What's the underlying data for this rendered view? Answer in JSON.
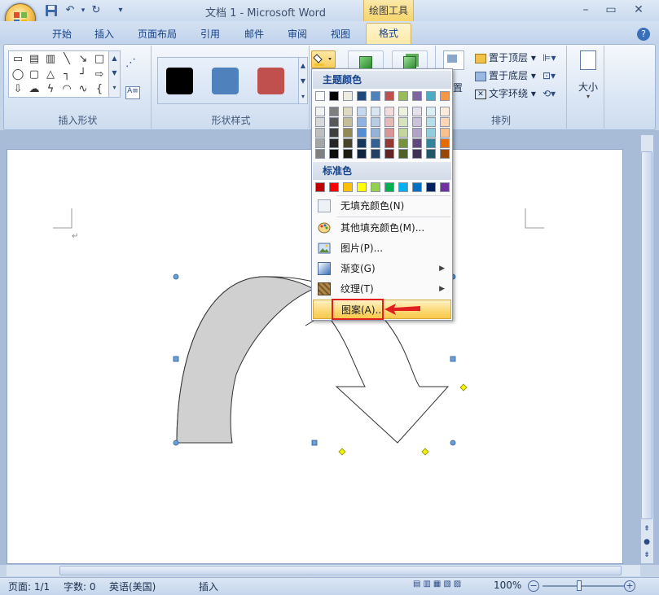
{
  "window": {
    "title": "文档 1 - Microsoft Word",
    "tool_context": "绘图工具",
    "controls": {
      "minimize": "–",
      "restore": "▭",
      "close": "✕"
    }
  },
  "qat": {
    "save": "save-icon",
    "undo": "undo-icon",
    "redo": "redo-icon",
    "customize": "▾"
  },
  "tabs": [
    "开始",
    "插入",
    "页面布局",
    "引用",
    "邮件",
    "审阅",
    "视图"
  ],
  "active_tab": "格式",
  "help": "?",
  "ribbon": {
    "insert_shapes_label": "插入形状",
    "shape_styles_label": "形状样式",
    "arrange_label": "排列",
    "size_label": "大小",
    "bring_front": "置于顶层",
    "send_back": "置于底层",
    "text_wrap": "文字环绕",
    "position_fragment": "置",
    "style_swatches": [
      "#000000",
      "#4f81bd",
      "#c0504d"
    ]
  },
  "fill_menu": {
    "theme_colors_title": "主题颜色",
    "standard_colors_title": "标准色",
    "theme_colors": [
      [
        "#ffffff",
        "#f2f2f2",
        "#d8d8d8",
        "#bfbfbf",
        "#a5a5a5",
        "#7f7f7f"
      ],
      [
        "#000000",
        "#7f7f7f",
        "#595959",
        "#3f3f3f",
        "#262626",
        "#0c0c0c"
      ],
      [
        "#eeece1",
        "#ddd9c3",
        "#c4bd97",
        "#938953",
        "#494429",
        "#1d1b10"
      ],
      [
        "#1f497d",
        "#c6d9f0",
        "#8db3e2",
        "#548dd4",
        "#17365d",
        "#0f243e"
      ],
      [
        "#4f81bd",
        "#dbe5f1",
        "#b8cce4",
        "#95b3d7",
        "#366092",
        "#244061"
      ],
      [
        "#c0504d",
        "#f2dcdb",
        "#e5b9b7",
        "#d99694",
        "#953734",
        "#632423"
      ],
      [
        "#9bbb59",
        "#ebf1dd",
        "#d7e3bc",
        "#c3d69b",
        "#76923c",
        "#4f6128"
      ],
      [
        "#8064a2",
        "#e5e0ec",
        "#ccc1d9",
        "#b2a2c7",
        "#5f497a",
        "#3f3151"
      ],
      [
        "#4bacc6",
        "#dbeef3",
        "#b7dde8",
        "#92cddc",
        "#31859b",
        "#205867"
      ],
      [
        "#f79646",
        "#fdeada",
        "#fbd5b5",
        "#fac08f",
        "#e36c09",
        "#974806"
      ]
    ],
    "standard_colors": [
      "#c00000",
      "#ff0000",
      "#ffc000",
      "#ffff00",
      "#92d050",
      "#00b050",
      "#00b0f0",
      "#0070c0",
      "#002060",
      "#7030a0"
    ],
    "items": {
      "no_fill": "无填充颜色(N)",
      "more_colors": "其他填充颜色(M)...",
      "picture": "图片(P)...",
      "gradient": "渐变(G)",
      "texture": "纹理(T)",
      "pattern": "图案(A)..."
    }
  },
  "statusbar": {
    "page": "页面: 1/1",
    "words": "字数: 0",
    "language": "英语(美国)",
    "insert_mode": "插入",
    "zoom": "100%"
  }
}
